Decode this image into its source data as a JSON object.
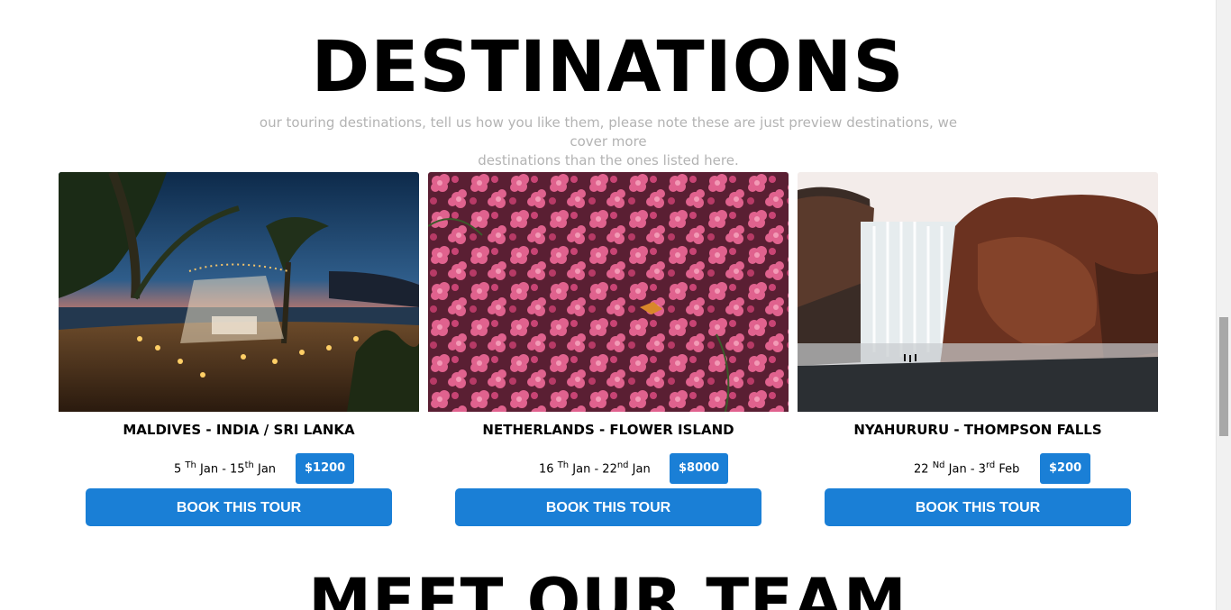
{
  "section": {
    "title": "DESTINATIONS",
    "subtitle_line1": "our touring destinations, tell us how you like them, please note these are just preview destinations, we cover more",
    "subtitle_line2": "destinations than the ones listed here."
  },
  "tours": [
    {
      "name": "MALDIVES - INDIA / SRI LANKA",
      "start_day": "5",
      "start_suffix": "Th",
      "start_month": "Jan",
      "end_day": "15",
      "end_suffix": "th",
      "end_month": "Jan",
      "price": "$1200",
      "button": "BOOK THIS TOUR"
    },
    {
      "name": "NETHERLANDS - FLOWER ISLAND",
      "start_day": "16",
      "start_suffix": "Th",
      "start_month": "Jan",
      "end_day": "22",
      "end_suffix": "nd",
      "end_month": "Jan",
      "price": "$8000",
      "button": "BOOK THIS TOUR"
    },
    {
      "name": "NYAHURURU - THOMPSON FALLS",
      "start_day": "22",
      "start_suffix": "Nd",
      "start_month": "Jan",
      "end_day": "3",
      "end_suffix": "rd",
      "end_month": "Feb",
      "price": "$200",
      "button": "BOOK THIS TOUR"
    }
  ],
  "next_section_title": "MEET OUR TEAM",
  "colors": {
    "accent": "#1a7fd6",
    "subtitle": "#b3b3b3"
  }
}
